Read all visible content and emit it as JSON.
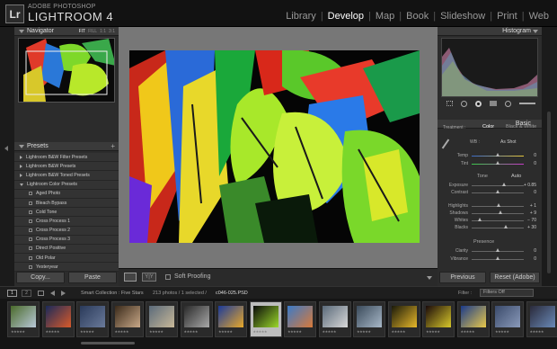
{
  "app": {
    "vendor": "ADOBE PHOTOSHOP",
    "name": "LIGHTROOM 4",
    "logo": "Lr"
  },
  "modules": [
    {
      "label": "Library"
    },
    {
      "label": "Develop",
      "active": true
    },
    {
      "label": "Map"
    },
    {
      "label": "Book"
    },
    {
      "label": "Slideshow"
    },
    {
      "label": "Print"
    },
    {
      "label": "Web"
    }
  ],
  "left": {
    "navigator": {
      "title": "Navigator",
      "options": [
        "FIT",
        "FILL",
        "1:1",
        "3:1"
      ]
    },
    "presets": {
      "title": "Presets",
      "items": [
        {
          "label": "Lightroom B&W Filter Presets",
          "type": "folder"
        },
        {
          "label": "Lightroom B&W Presets",
          "type": "folder"
        },
        {
          "label": "Lightroom B&W Toned Presets",
          "type": "folder"
        },
        {
          "label": "Lightroom Color Presets",
          "type": "folder-open"
        },
        {
          "label": "Aged Photo",
          "type": "preset"
        },
        {
          "label": "Bleach Bypass",
          "type": "preset"
        },
        {
          "label": "Cold Tone",
          "type": "preset"
        },
        {
          "label": "Cross Process 1",
          "type": "preset"
        },
        {
          "label": "Cross Process 2",
          "type": "preset"
        },
        {
          "label": "Cross Process 3",
          "type": "preset"
        },
        {
          "label": "Direct Positive",
          "type": "preset"
        },
        {
          "label": "Old Polar",
          "type": "preset"
        },
        {
          "label": "Yesteryear",
          "type": "preset"
        }
      ]
    },
    "copy_label": "Copy...",
    "paste_label": "Paste"
  },
  "toolbar": {
    "soft_proofing": "Soft Proofing"
  },
  "right": {
    "histogram_title": "Histogram",
    "basic_title": "Basic",
    "treatment": {
      "label": "Treatment :",
      "color": "Color",
      "bw": "Black & White"
    },
    "wb": {
      "label": "WB :",
      "value": "As Shot"
    },
    "temp": {
      "label": "Temp",
      "value": "0",
      "pos": 0.5
    },
    "tint": {
      "label": "Tint",
      "value": "0",
      "pos": 0.5
    },
    "tone": {
      "label": "Tone",
      "auto": "Auto"
    },
    "exposure": {
      "label": "Exposure",
      "value": "+ 0.85",
      "pos": 0.62
    },
    "contrast": {
      "label": "Contrast",
      "value": "0",
      "pos": 0.5
    },
    "highlights": {
      "label": "Highlights",
      "value": "+ 1",
      "pos": 0.52
    },
    "shadows": {
      "label": "Shadows",
      "value": "+ 9",
      "pos": 0.55
    },
    "whites": {
      "label": "Whites",
      "value": "− 70",
      "pos": 0.15
    },
    "blacks": {
      "label": "Blacks",
      "value": "+ 30",
      "pos": 0.65
    },
    "presence": {
      "label": "Presence"
    },
    "clarity": {
      "label": "Clarity",
      "value": "0",
      "pos": 0.5
    },
    "vibrance": {
      "label": "Vibrance",
      "value": "0",
      "pos": 0.5
    },
    "previous_label": "Previous",
    "reset_label": "Reset (Adobe)"
  },
  "filmbar": {
    "page1": "1",
    "page2": "2",
    "source": "Smart Collection : Five Stars",
    "count": "213 photos / 1 selected /",
    "file": "c046-025.PSD",
    "filter_label": "Filter :",
    "filter_value": "Filters Off"
  },
  "filmstrip": {
    "thumbs": [
      {
        "c1": "#4a6a2a",
        "c2": "#b8c8d8"
      },
      {
        "c1": "#1a2a5a",
        "c2": "#d85a2a"
      },
      {
        "c1": "#2a3a5a",
        "c2": "#6a7a9a"
      },
      {
        "c1": "#3a2a1a",
        "c2": "#c8a888"
      },
      {
        "c1": "#5a6a7a",
        "c2": "#c8b898"
      },
      {
        "c1": "#2a2a2a",
        "c2": "#a8a8a8"
      },
      {
        "c1": "#1a3a9a",
        "c2": "#e8a82a"
      },
      {
        "c1": "#0a0a0a",
        "c2": "#9ad82a",
        "sel": true
      },
      {
        "c1": "#3a7ac8",
        "c2": "#d87a3a"
      },
      {
        "c1": "#5a6a7a",
        "c2": "#d8d8d8"
      },
      {
        "c1": "#3a4a5a",
        "c2": "#a8b8c8"
      },
      {
        "c1": "#1a1a0a",
        "c2": "#e8b82a"
      },
      {
        "c1": "#1a0a0a",
        "c2": "#d8c82a"
      },
      {
        "c1": "#1a3a8a",
        "c2": "#e8c84a"
      },
      {
        "c1": "#3a4a6a",
        "c2": "#8a9aba"
      },
      {
        "c1": "#2a2a3a",
        "c2": "#6a8ab8"
      }
    ],
    "stars": "★★★★★"
  },
  "icons": {
    "accent": "#ffffff",
    "dim": "#999999"
  }
}
